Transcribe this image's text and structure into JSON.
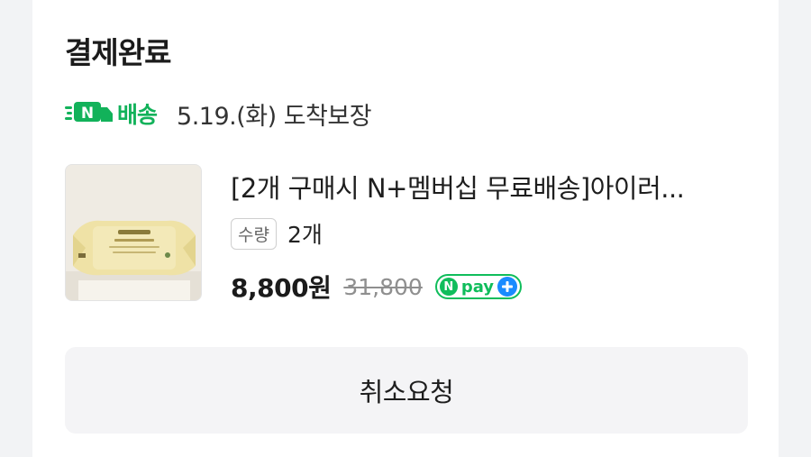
{
  "order": {
    "status_title": "결제완료",
    "delivery": {
      "badge_label": "배송",
      "badge_icon": "n-delivery-truck-icon",
      "brand_color": "#12b25a",
      "date_text": "5.19.(화) 도착보장"
    },
    "product": {
      "title": "[2개 구매시 N+멤버십 무료배송]아이러...",
      "quantity_tag": "수량",
      "quantity_value": "2개",
      "price": "8,800원",
      "original_price": "31,800",
      "pay_badge": {
        "n_mark": "N",
        "text": "pay",
        "plus_icon": "plus-icon",
        "color": "#0fbd5b",
        "plus_color": "#1a8bff"
      }
    },
    "cancel_button_label": "취소요청"
  }
}
